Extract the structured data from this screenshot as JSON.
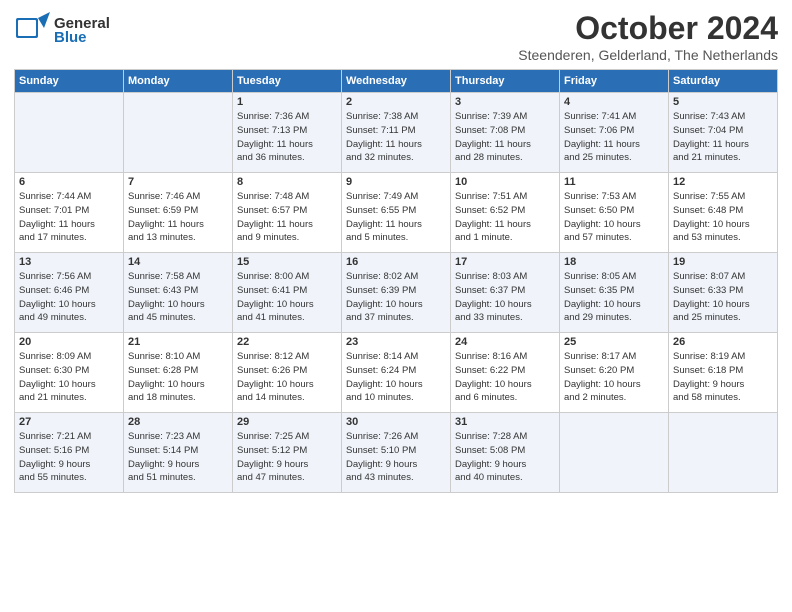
{
  "logo": {
    "general": "General",
    "blue": "Blue",
    "bird": "▲"
  },
  "title": "October 2024",
  "location": "Steenderen, Gelderland, The Netherlands",
  "days_header": [
    "Sunday",
    "Monday",
    "Tuesday",
    "Wednesday",
    "Thursday",
    "Friday",
    "Saturday"
  ],
  "weeks": [
    [
      {
        "num": "",
        "info": ""
      },
      {
        "num": "",
        "info": ""
      },
      {
        "num": "1",
        "info": "Sunrise: 7:36 AM\nSunset: 7:13 PM\nDaylight: 11 hours\nand 36 minutes."
      },
      {
        "num": "2",
        "info": "Sunrise: 7:38 AM\nSunset: 7:11 PM\nDaylight: 11 hours\nand 32 minutes."
      },
      {
        "num": "3",
        "info": "Sunrise: 7:39 AM\nSunset: 7:08 PM\nDaylight: 11 hours\nand 28 minutes."
      },
      {
        "num": "4",
        "info": "Sunrise: 7:41 AM\nSunset: 7:06 PM\nDaylight: 11 hours\nand 25 minutes."
      },
      {
        "num": "5",
        "info": "Sunrise: 7:43 AM\nSunset: 7:04 PM\nDaylight: 11 hours\nand 21 minutes."
      }
    ],
    [
      {
        "num": "6",
        "info": "Sunrise: 7:44 AM\nSunset: 7:01 PM\nDaylight: 11 hours\nand 17 minutes."
      },
      {
        "num": "7",
        "info": "Sunrise: 7:46 AM\nSunset: 6:59 PM\nDaylight: 11 hours\nand 13 minutes."
      },
      {
        "num": "8",
        "info": "Sunrise: 7:48 AM\nSunset: 6:57 PM\nDaylight: 11 hours\nand 9 minutes."
      },
      {
        "num": "9",
        "info": "Sunrise: 7:49 AM\nSunset: 6:55 PM\nDaylight: 11 hours\nand 5 minutes."
      },
      {
        "num": "10",
        "info": "Sunrise: 7:51 AM\nSunset: 6:52 PM\nDaylight: 11 hours\nand 1 minute."
      },
      {
        "num": "11",
        "info": "Sunrise: 7:53 AM\nSunset: 6:50 PM\nDaylight: 10 hours\nand 57 minutes."
      },
      {
        "num": "12",
        "info": "Sunrise: 7:55 AM\nSunset: 6:48 PM\nDaylight: 10 hours\nand 53 minutes."
      }
    ],
    [
      {
        "num": "13",
        "info": "Sunrise: 7:56 AM\nSunset: 6:46 PM\nDaylight: 10 hours\nand 49 minutes."
      },
      {
        "num": "14",
        "info": "Sunrise: 7:58 AM\nSunset: 6:43 PM\nDaylight: 10 hours\nand 45 minutes."
      },
      {
        "num": "15",
        "info": "Sunrise: 8:00 AM\nSunset: 6:41 PM\nDaylight: 10 hours\nand 41 minutes."
      },
      {
        "num": "16",
        "info": "Sunrise: 8:02 AM\nSunset: 6:39 PM\nDaylight: 10 hours\nand 37 minutes."
      },
      {
        "num": "17",
        "info": "Sunrise: 8:03 AM\nSunset: 6:37 PM\nDaylight: 10 hours\nand 33 minutes."
      },
      {
        "num": "18",
        "info": "Sunrise: 8:05 AM\nSunset: 6:35 PM\nDaylight: 10 hours\nand 29 minutes."
      },
      {
        "num": "19",
        "info": "Sunrise: 8:07 AM\nSunset: 6:33 PM\nDaylight: 10 hours\nand 25 minutes."
      }
    ],
    [
      {
        "num": "20",
        "info": "Sunrise: 8:09 AM\nSunset: 6:30 PM\nDaylight: 10 hours\nand 21 minutes."
      },
      {
        "num": "21",
        "info": "Sunrise: 8:10 AM\nSunset: 6:28 PM\nDaylight: 10 hours\nand 18 minutes."
      },
      {
        "num": "22",
        "info": "Sunrise: 8:12 AM\nSunset: 6:26 PM\nDaylight: 10 hours\nand 14 minutes."
      },
      {
        "num": "23",
        "info": "Sunrise: 8:14 AM\nSunset: 6:24 PM\nDaylight: 10 hours\nand 10 minutes."
      },
      {
        "num": "24",
        "info": "Sunrise: 8:16 AM\nSunset: 6:22 PM\nDaylight: 10 hours\nand 6 minutes."
      },
      {
        "num": "25",
        "info": "Sunrise: 8:17 AM\nSunset: 6:20 PM\nDaylight: 10 hours\nand 2 minutes."
      },
      {
        "num": "26",
        "info": "Sunrise: 8:19 AM\nSunset: 6:18 PM\nDaylight: 9 hours\nand 58 minutes."
      }
    ],
    [
      {
        "num": "27",
        "info": "Sunrise: 7:21 AM\nSunset: 5:16 PM\nDaylight: 9 hours\nand 55 minutes."
      },
      {
        "num": "28",
        "info": "Sunrise: 7:23 AM\nSunset: 5:14 PM\nDaylight: 9 hours\nand 51 minutes."
      },
      {
        "num": "29",
        "info": "Sunrise: 7:25 AM\nSunset: 5:12 PM\nDaylight: 9 hours\nand 47 minutes."
      },
      {
        "num": "30",
        "info": "Sunrise: 7:26 AM\nSunset: 5:10 PM\nDaylight: 9 hours\nand 43 minutes."
      },
      {
        "num": "31",
        "info": "Sunrise: 7:28 AM\nSunset: 5:08 PM\nDaylight: 9 hours\nand 40 minutes."
      },
      {
        "num": "",
        "info": ""
      },
      {
        "num": "",
        "info": ""
      }
    ]
  ]
}
